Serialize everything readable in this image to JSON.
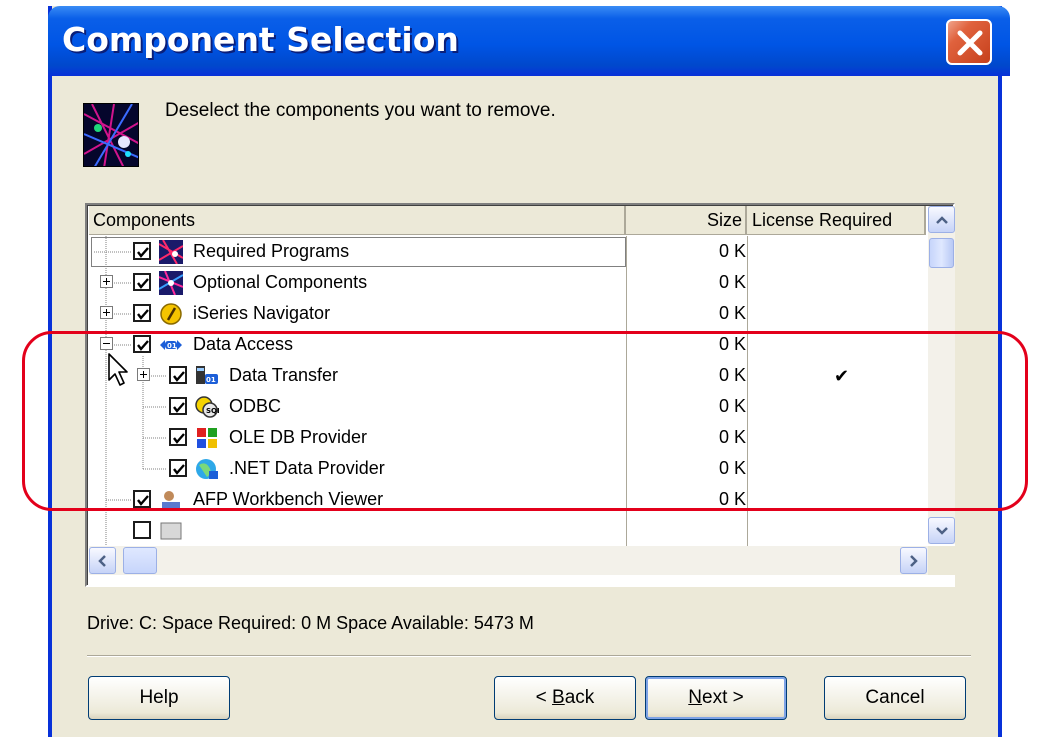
{
  "window": {
    "title": "Component Selection"
  },
  "header": {
    "instruction": "Deselect the components you want to remove."
  },
  "list": {
    "columns": {
      "components": "Components",
      "size": "Size",
      "license": "License Required"
    },
    "rows": [
      {
        "label": "Required Programs",
        "size": "0 K",
        "license": "",
        "checked": true,
        "expander": "none",
        "icon": "required-programs-icon"
      },
      {
        "label": "Optional Components",
        "size": "0 K",
        "license": "",
        "checked": true,
        "expander": "plus",
        "icon": "optional-components-icon"
      },
      {
        "label": "iSeries Navigator",
        "size": "0 K",
        "license": "",
        "checked": true,
        "expander": "plus",
        "icon": "iseries-navigator-icon"
      },
      {
        "label": "Data Access",
        "size": "0 K",
        "license": "",
        "checked": true,
        "expander": "minus",
        "icon": "data-access-icon"
      },
      {
        "label": "Data Transfer",
        "size": "0 K",
        "license": "✔",
        "checked": true,
        "expander": "plus",
        "icon": "data-transfer-icon"
      },
      {
        "label": "ODBC",
        "size": "0 K",
        "license": "",
        "checked": true,
        "expander": "none",
        "icon": "odbc-icon"
      },
      {
        "label": "OLE DB Provider",
        "size": "0 K",
        "license": "",
        "checked": true,
        "expander": "none",
        "icon": "ole-db-icon"
      },
      {
        "label": ".NET Data Provider",
        "size": "0 K",
        "license": "",
        "checked": true,
        "expander": "none",
        "icon": "net-data-provider-icon"
      },
      {
        "label": "AFP Workbench Viewer",
        "size": "0 K",
        "license": "",
        "checked": true,
        "expander": "none",
        "icon": "afp-workbench-icon"
      }
    ]
  },
  "status": {
    "text": "Drive:  C:   Space Required:  0 M   Space Available:  5473 M"
  },
  "buttons": {
    "help": "Help",
    "back_prefix": "< ",
    "back_mnemonic": "B",
    "back_rest": "ack",
    "next_mnemonic": "N",
    "next_rest": "ext >",
    "cancel": "Cancel"
  },
  "colors": {
    "titlebar": "#0055e5",
    "dialog_bg": "#ece9d8",
    "highlight": "#e3001b"
  }
}
